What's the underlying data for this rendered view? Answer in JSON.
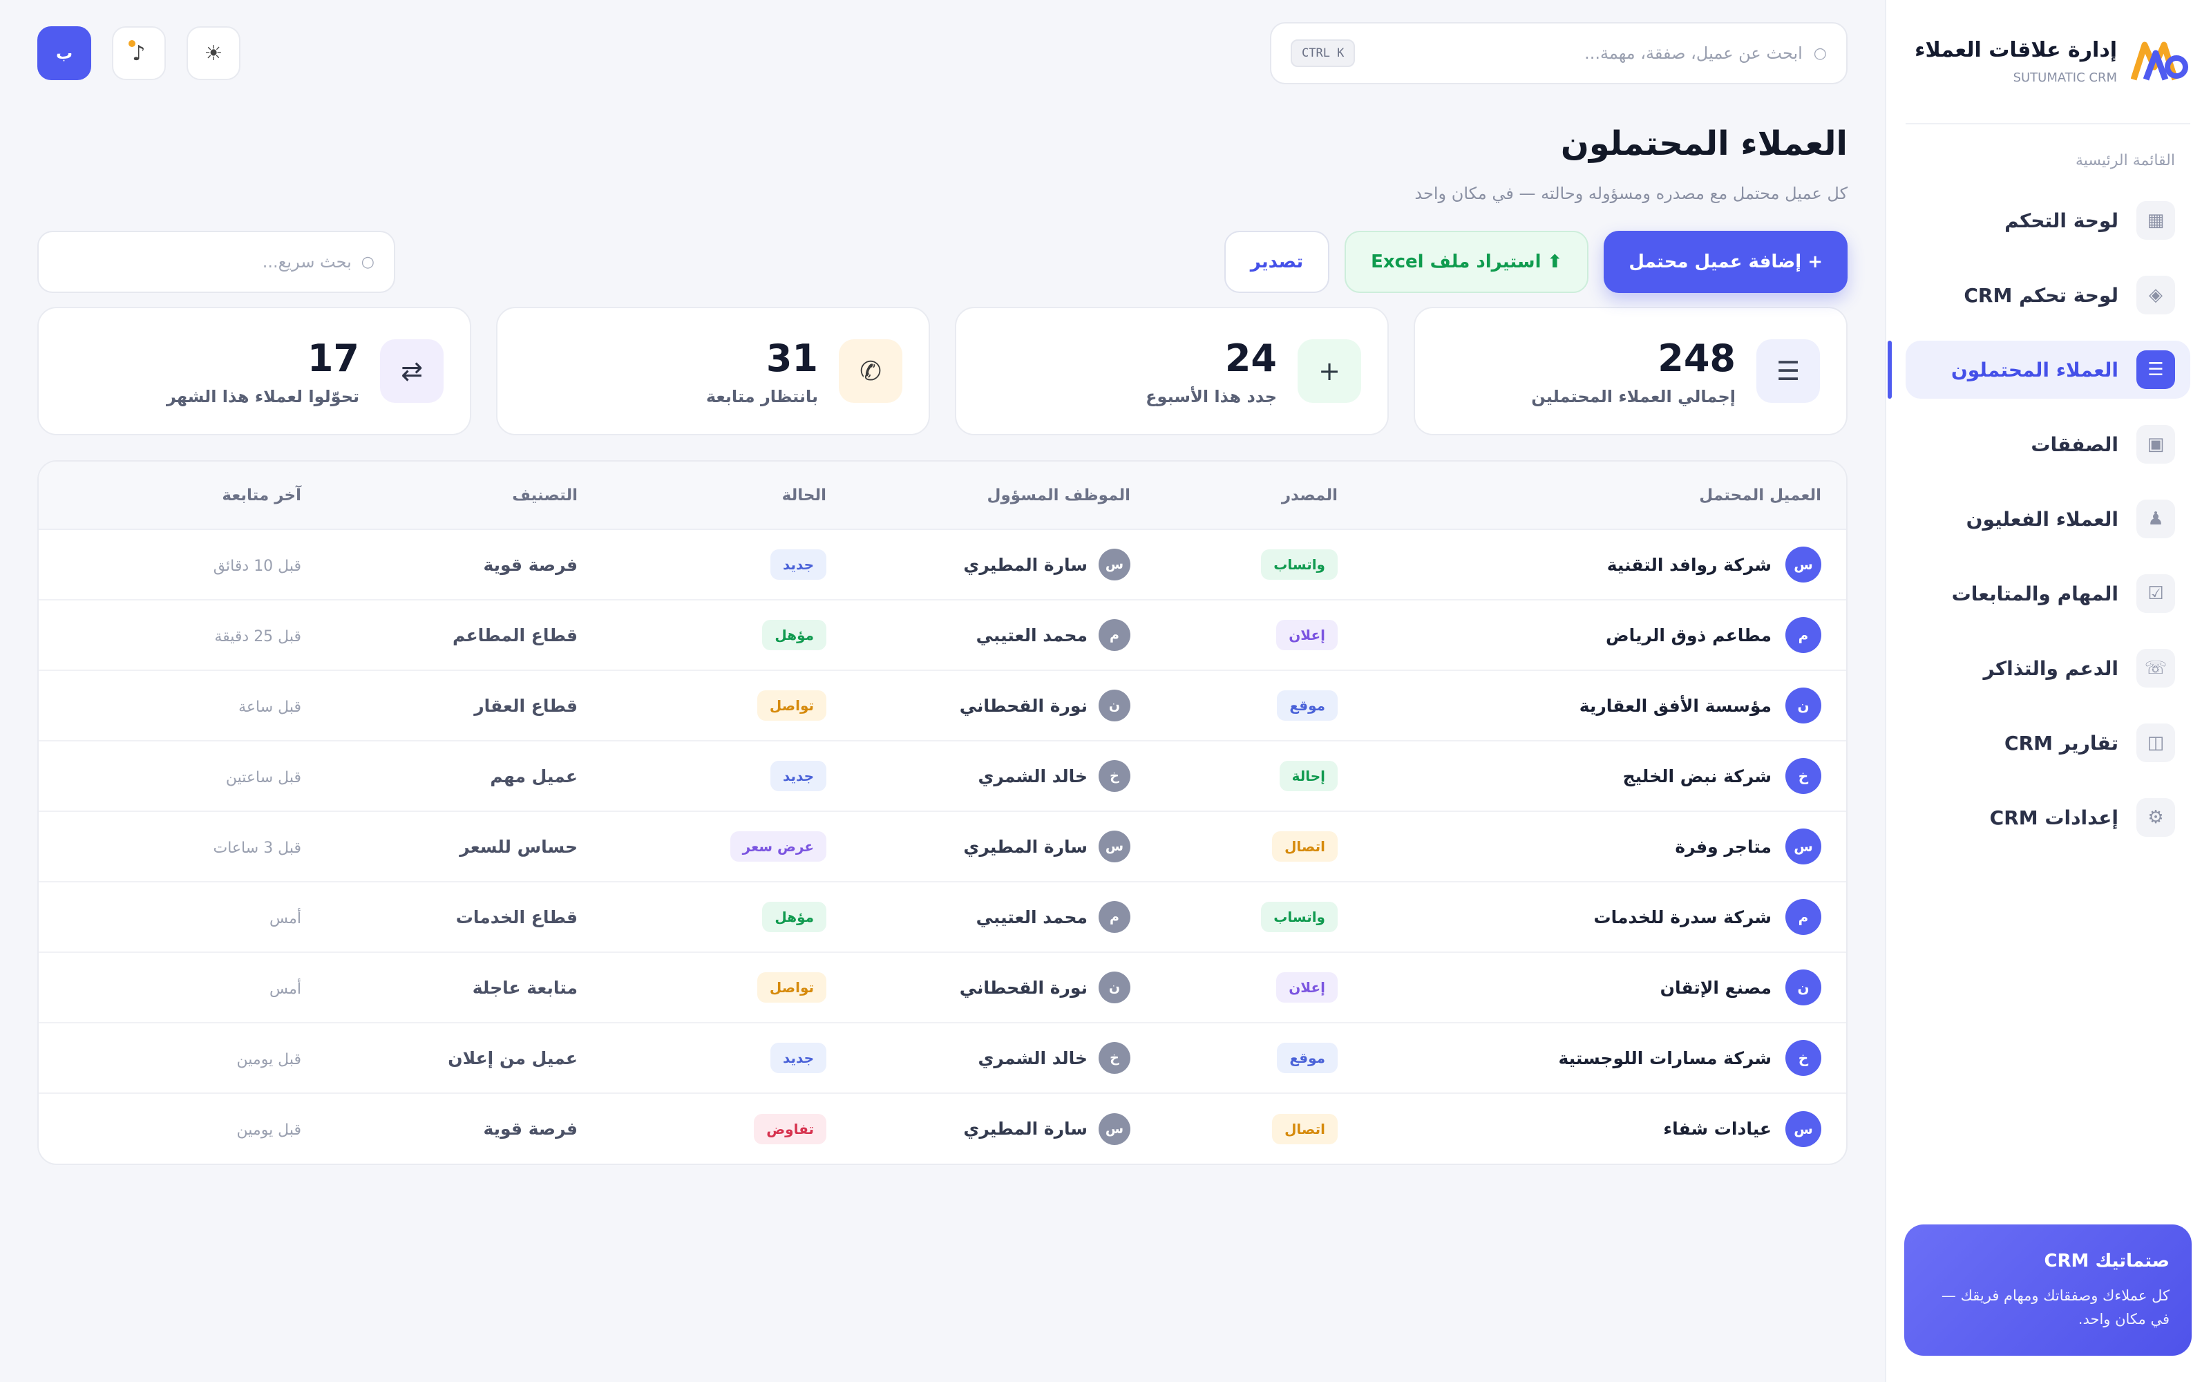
{
  "brand": {
    "title": "إدارة علاقات العملاء",
    "subtitle": "SUTUMATIC CRM",
    "logo": "SM"
  },
  "nav": {
    "section_title": "القائمة الرئيسية",
    "items": [
      {
        "label": "لوحة التحكم",
        "icon": "▦",
        "active": false
      },
      {
        "label": "لوحة تحكم CRM",
        "icon": "◈",
        "active": false
      },
      {
        "label": "العملاء المحتملون",
        "icon": "☰",
        "active": true
      },
      {
        "label": "الصفقات",
        "icon": "▣",
        "active": false
      },
      {
        "label": "العملاء الفعليون",
        "icon": "♟",
        "active": false
      },
      {
        "label": "المهام والمتابعات",
        "icon": "☑",
        "active": false
      },
      {
        "label": "الدعم والتذاكر",
        "icon": "☏",
        "active": false
      },
      {
        "label": "تقارير CRM",
        "icon": "◫",
        "active": false
      },
      {
        "label": "إعدادات CRM",
        "icon": "⚙",
        "active": false
      }
    ]
  },
  "promo": {
    "title": "صتماتيك CRM",
    "text": "كل عملاءك وصفقاتك ومهام فريقك — في مكان واحد."
  },
  "topbar": {
    "search_placeholder": "ابحث عن عميل، صفقة، مهمة...",
    "shortcut": "CTRL K",
    "user_initial": "ب",
    "notif_icon": "♪",
    "theme_icon": "☀"
  },
  "page": {
    "title": "العملاء المحتملون",
    "subtitle": "كل عميل محتمل مع مصدره ومسؤوله وحالته — في مكان واحد"
  },
  "actions": {
    "add": "+ إضافة عميل محتمل",
    "import": "⬆ استيراد ملف Excel",
    "export": "تصدير",
    "quick_search_placeholder": "بحث سريع..."
  },
  "stats": [
    {
      "value": "248",
      "label": "إجمالي العملاء المحتملين",
      "icon": "☰",
      "bg": "#eef0fd",
      "fg": "#3b4254"
    },
    {
      "value": "24",
      "label": "جدد هذا الأسبوع",
      "icon": "+",
      "bg": "#eafaf0",
      "fg": "#2f3a44"
    },
    {
      "value": "31",
      "label": "بانتظار متابعة",
      "icon": "✆",
      "bg": "#fff4e2",
      "fg": "#3b3b3b"
    },
    {
      "value": "17",
      "label": "تحوّلوا لعملاء هذا الشهر",
      "icon": "⇄",
      "bg": "#f1eefd",
      "fg": "#2f3447"
    }
  ],
  "table": {
    "headers": [
      "العميل المحتمل",
      "المصدر",
      "الموظف المسؤول",
      "الحالة",
      "التصنيف",
      "آخر متابعة"
    ],
    "rows": [
      {
        "initial": "س",
        "client": "شركة روافد التقنية",
        "source": "واتساب",
        "owner_initial": "س",
        "owner": "سارة المطيري",
        "status": "جديد",
        "category": "فرصة قوية",
        "last": "قبل 10 دقائق"
      },
      {
        "initial": "م",
        "client": "مطاعم ذوق الرياض",
        "source": "إعلان",
        "owner_initial": "م",
        "owner": "محمد العتيبي",
        "status": "مؤهل",
        "category": "قطاع المطاعم",
        "last": "قبل 25 دقيقة"
      },
      {
        "initial": "ن",
        "client": "مؤسسة الأفق العقارية",
        "source": "موقع",
        "owner_initial": "ن",
        "owner": "نورة القحطاني",
        "status": "تواصل",
        "category": "قطاع العقار",
        "last": "قبل ساعة"
      },
      {
        "initial": "خ",
        "client": "شركة نبض الخليج",
        "source": "إحالة",
        "owner_initial": "خ",
        "owner": "خالد الشمري",
        "status": "جديد",
        "category": "عميل مهم",
        "last": "قبل ساعتين"
      },
      {
        "initial": "س",
        "client": "متاجر وفرة",
        "source": "اتصال",
        "owner_initial": "س",
        "owner": "سارة المطيري",
        "status": "عرض سعر",
        "category": "حساس للسعر",
        "last": "قبل 3 ساعات"
      },
      {
        "initial": "م",
        "client": "شركة سدرة للخدمات",
        "source": "واتساب",
        "owner_initial": "م",
        "owner": "محمد العتيبي",
        "status": "مؤهل",
        "category": "قطاع الخدمات",
        "last": "أمس"
      },
      {
        "initial": "ن",
        "client": "مصنع الإتقان",
        "source": "إعلان",
        "owner_initial": "ن",
        "owner": "نورة القحطاني",
        "status": "تواصل",
        "category": "متابعة عاجلة",
        "last": "أمس"
      },
      {
        "initial": "خ",
        "client": "شركة مسارات اللوجستية",
        "source": "موقع",
        "owner_initial": "خ",
        "owner": "خالد الشمري",
        "status": "جديد",
        "category": "عميل من إعلان",
        "last": "قبل يومين"
      },
      {
        "initial": "س",
        "client": "عيادات شفاء",
        "source": "اتصال",
        "owner_initial": "س",
        "owner": "سارة المطيري",
        "status": "تفاوض",
        "category": "فرصة قوية",
        "last": "قبل يومين"
      }
    ]
  },
  "badge_colors": {
    "واتساب": [
      "#e6f8ee",
      "#109a4f"
    ],
    "إعلان": [
      "#f1edfd",
      "#7b55e0"
    ],
    "موقع": [
      "#eaf0fd",
      "#4a62d8"
    ],
    "إحالة": [
      "#e6f8ee",
      "#109a4f"
    ],
    "اتصال": [
      "#fff4df",
      "#d68a0c"
    ],
    "جديد": [
      "#eaf0fd",
      "#4a62d8"
    ],
    "مؤهل": [
      "#e6f8ee",
      "#109a4f"
    ],
    "تواصل": [
      "#fff4df",
      "#d68a0c"
    ],
    "عرض سعر": [
      "#f1edfd",
      "#7b55e0"
    ],
    "تفاوض": [
      "#fdeaee",
      "#d6334f"
    ]
  }
}
